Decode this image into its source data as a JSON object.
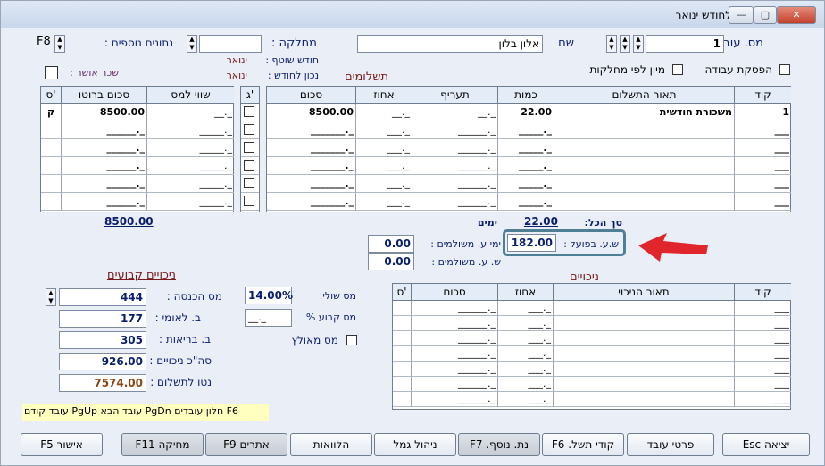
{
  "title": "הכנת השכר לחודש ינואר",
  "window_buttons": {
    "minimize": "▭",
    "restore": "▭",
    "close": "✕"
  },
  "header": {
    "employee_no_label": "מס. עובד :",
    "employee_no_value": "1",
    "name_label": "שם",
    "name_value": "אלון בלון",
    "department_label": "מחלקה :",
    "department_value": "",
    "extra_data_label": "נתונים נוספים :",
    "extra_data_value": "F8",
    "stop_work_label": "הפסקת עבודה",
    "sort_by_dept_label": "מיון לפי מחלקות",
    "current_month_label": "חודש שוטף :",
    "current_month_value": "ינואר",
    "correct_month_label": "נכון לחודש :",
    "correct_month_value": "ינואר",
    "approved_wage_label": "שכר אושר :"
  },
  "payments": {
    "title": "תשלומים",
    "headers": [
      "קוד",
      "תאור התשלום",
      "כמות",
      "תעריף",
      "אחוז",
      "סכום",
      "ג'",
      "שווי למס",
      "סכום ברוטו",
      "ס'"
    ],
    "rows": [
      {
        "code": "1",
        "desc": "משכורת חודשית",
        "qty": "22.00",
        "rate": "__._",
        "pct": "__._",
        "amount": "8500.00",
        "g": "",
        "tax_value": "__._",
        "gross": "8500.00",
        "s": "ק"
      },
      {
        "code": "___",
        "desc": "",
        "qty": "_____._",
        "rate": "______._",
        "pct": "___._",
        "amount": "_______._",
        "g": "",
        "tax_value": "_____._",
        "gross": "______._",
        "s": ""
      },
      {
        "code": "___",
        "desc": "",
        "qty": "_____._",
        "rate": "______._",
        "pct": "___._",
        "amount": "_______._",
        "g": "",
        "tax_value": "_____._",
        "gross": "______._",
        "s": ""
      },
      {
        "code": "___",
        "desc": "",
        "qty": "_____._",
        "rate": "______._",
        "pct": "___._",
        "amount": "_______._",
        "g": "",
        "tax_value": "_____._",
        "gross": "______._",
        "s": ""
      },
      {
        "code": "___",
        "desc": "",
        "qty": "_____._",
        "rate": "______._",
        "pct": "___._",
        "amount": "_______._",
        "g": "",
        "tax_value": "_____._",
        "gross": "______._",
        "s": ""
      },
      {
        "code": "___",
        "desc": "",
        "qty": "_____._",
        "rate": "______._",
        "pct": "___._",
        "amount": "_______._",
        "g": "",
        "tax_value": "_____._",
        "gross": "______._",
        "s": ""
      }
    ],
    "total_label": "סך הכל:",
    "total_qty": "22.00",
    "days_label": "ימים",
    "total_gross": "8500.00"
  },
  "hours": {
    "actual_hours_label": "ש.ע. בפועל :",
    "actual_hours_value": "182.00",
    "paid_days_label": "ימי ע. משולמים :",
    "paid_days_value": "0.00",
    "paid_hours_label": "ש. ע. משולמים :",
    "paid_hours_value": "0.00"
  },
  "fixed_deductions": {
    "title": "ניכויים קבועים",
    "income_tax_label": "מס הכנסה :",
    "income_tax_value": "444",
    "national_ins_label": "ב. לאומי :",
    "national_ins_value": "177",
    "health_label": "ב. בריאות :",
    "health_value": "305",
    "total_deductions_label": "סה\"כ ניכויים :",
    "total_deductions_value": "926.00",
    "net_label": "נטו לתשלום :",
    "net_value": "7574.00",
    "marginal_tax_label": "מס שולי:",
    "marginal_tax_value": "14.00%",
    "fixed_tax_label": "מס קבוע %",
    "fixed_tax_value": "__._",
    "forced_tax_label": "מס מאולץ"
  },
  "deductions": {
    "title": "ניכויים",
    "headers": [
      "קוד",
      "תאור הניכוי",
      "אחוז",
      "סכום",
      "ס'"
    ],
    "rows": [
      {
        "code": "___",
        "desc": "",
        "pct": "___._",
        "amount": "______._"
      },
      {
        "code": "___",
        "desc": "",
        "pct": "___._",
        "amount": "______._"
      },
      {
        "code": "___",
        "desc": "",
        "pct": "___._",
        "amount": "______._"
      },
      {
        "code": "___",
        "desc": "",
        "pct": "___._",
        "amount": "______._"
      },
      {
        "code": "___",
        "desc": "",
        "pct": "___._",
        "amount": "______._"
      },
      {
        "code": "___",
        "desc": "",
        "pct": "___._",
        "amount": "______._"
      },
      {
        "code": "___",
        "desc": "",
        "pct": "___._",
        "amount": "______._"
      }
    ]
  },
  "hint": "F6 חלון עובדים  PgDn עובד הבא  PgUp עובד קודם",
  "buttons": {
    "exit": "יציאה Esc",
    "employee_details": "פרטי עובד",
    "payment_codes": "קודי תשל. F6",
    "additional_data": "נת. נוסף. F7",
    "leave_mgmt": "ניהול גמל",
    "loans": "הלוואות",
    "alerts": "אתרים F9",
    "delete": "מחיקה F11",
    "approve": "אישור F5"
  },
  "colors": {
    "accent_red": "#e0262c",
    "highlight_border": "#4f7f95",
    "net_color": "#8b4513"
  }
}
